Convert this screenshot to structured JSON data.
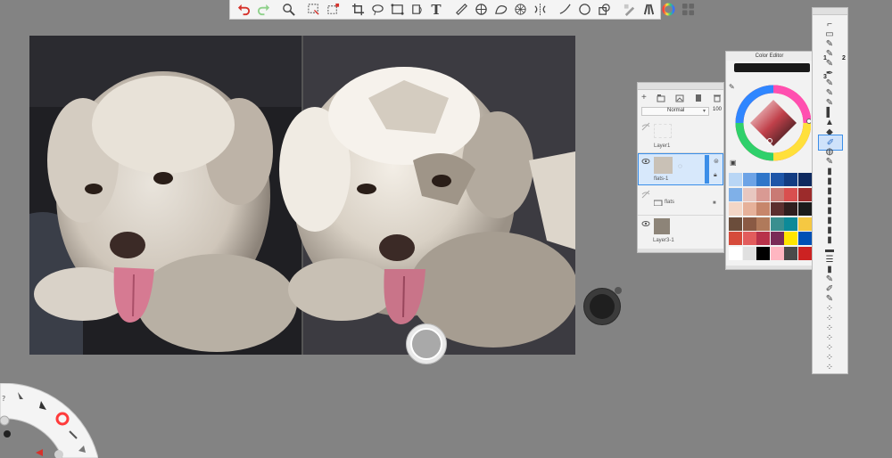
{
  "toolbar": {
    "tools": [
      {
        "name": "undo-icon"
      },
      {
        "name": "redo-icon"
      },
      {
        "name": "magnifier-icon"
      },
      {
        "name": "selection-icon"
      },
      {
        "name": "crop-selection-icon"
      },
      {
        "name": "crop-icon"
      },
      {
        "name": "lasso-icon"
      },
      {
        "name": "transform-icon"
      },
      {
        "name": "fill-icon"
      },
      {
        "name": "text-icon"
      },
      {
        "name": "ruler-icon"
      },
      {
        "name": "ellipse-guide-icon"
      },
      {
        "name": "french-curve-icon"
      },
      {
        "name": "perspective-icon"
      },
      {
        "name": "symmetry-icon"
      },
      {
        "name": "stroke-icon"
      },
      {
        "name": "shape-circle-icon"
      },
      {
        "name": "shape-icon"
      },
      {
        "name": "copic-icon"
      },
      {
        "name": "brush-library-icon"
      },
      {
        "name": "color-wheel-icon"
      },
      {
        "name": "swatches-icon"
      }
    ],
    "text_tool_glyph": "T"
  },
  "layers": {
    "blend_mode": "Normal",
    "opacity": "100",
    "items": [
      {
        "name": "Layer1"
      },
      {
        "name": "flats-1"
      },
      {
        "name": "flats"
      },
      {
        "name": "Layer3-1"
      }
    ]
  },
  "color_editor": {
    "title": "Color Editor",
    "current_color": "#1a1a1a",
    "swatches": [
      "#b9d6f5",
      "#6da3e6",
      "#2f76c9",
      "#1e56a8",
      "#123c82",
      "#0f2a5f",
      "#7fb0e8",
      "#e8c7c0",
      "#d99a93",
      "#c97a74",
      "#d94f4f",
      "#9c2b2b",
      "#f3d6c6",
      "#e6b19a",
      "#c7866b",
      "#5c2f2f",
      "#2f1e1e",
      "#1b1b1b",
      "#6b4d3b",
      "#8a5a44",
      "#b07a5b",
      "#3a8f8f",
      "#0c8a98",
      "#f5c842",
      "#d64b3b",
      "#e25c5c",
      "#b8324a",
      "#7a2b57",
      "#ffe600",
      "#0050b5",
      "#ffffff",
      "#e0e0e0",
      "#000000",
      "#ffb6c1",
      "#4a4a4a",
      "#cc2222"
    ]
  },
  "brushes": {
    "marks": [
      "1",
      "2",
      "3"
    ]
  },
  "colors": {
    "background": "#838383",
    "canvas_bg": "#3a393e",
    "panel_bg": "#f2f2f2",
    "selected_layer": "#d7e8fb",
    "accent": "#3b8ee8"
  }
}
